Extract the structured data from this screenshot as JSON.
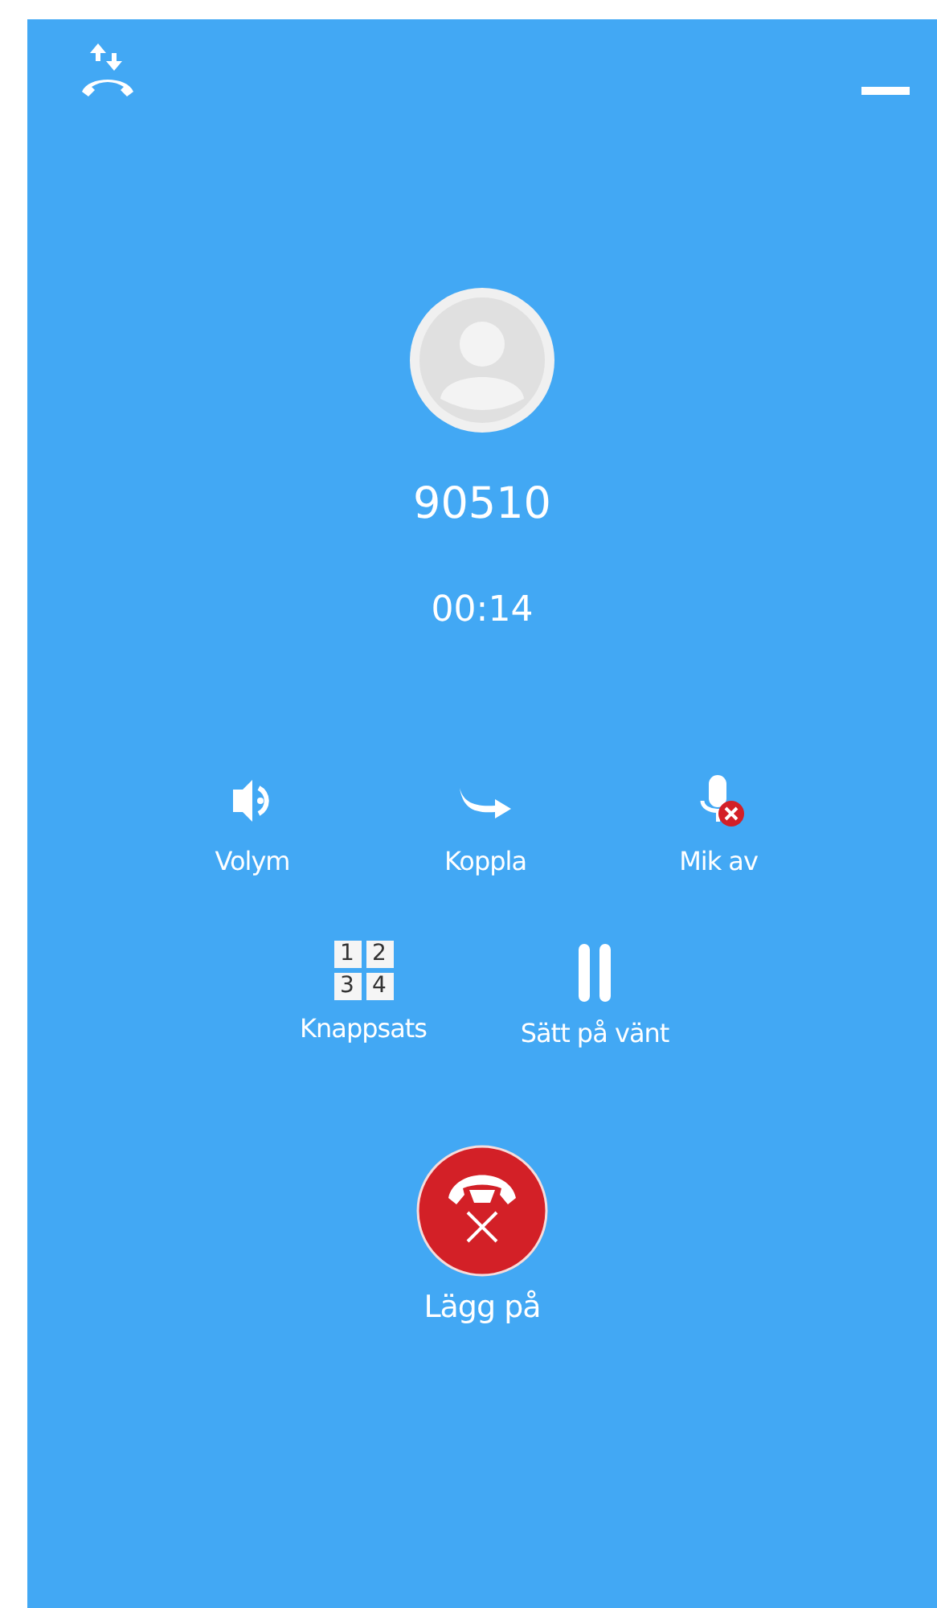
{
  "caller": {
    "number": "90510",
    "duration": "00:14"
  },
  "action_rows": [
    [
      {
        "kind": "volume",
        "label": "Volym"
      },
      {
        "kind": "transfer",
        "label": "Koppla"
      },
      {
        "kind": "mute",
        "label": "Mik av"
      }
    ],
    [
      {
        "kind": "keypad",
        "label": "Knappsats",
        "keys": [
          "1",
          "2",
          "3",
          "4"
        ]
      },
      {
        "kind": "hold",
        "label": "Sätt på vänt"
      }
    ]
  ],
  "hangup": {
    "label": "Lägg på"
  }
}
